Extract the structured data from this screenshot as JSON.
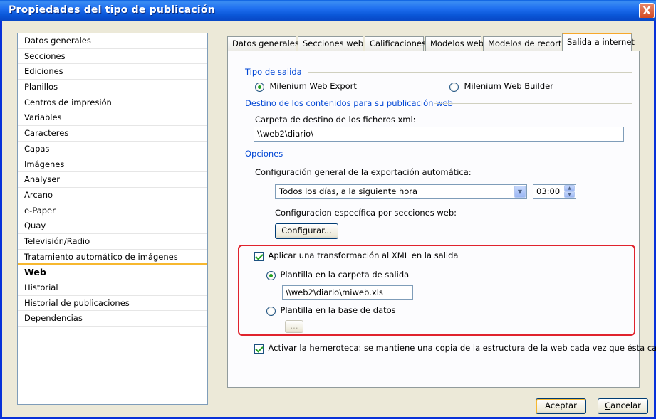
{
  "window": {
    "title": "Propiedades del tipo de publicación",
    "close_label": "X"
  },
  "sidebar": {
    "items": [
      "Datos generales",
      "Secciones",
      "Ediciones",
      "Planillos",
      "Centros de impresión",
      "Variables",
      "Caracteres",
      "Capas",
      "Imágenes",
      "Analyser",
      "Arcano",
      "e-Paper",
      "Quay",
      "Televisión/Radio",
      "Tratamiento automático de imágenes",
      "Web",
      "Historial",
      "Historial de publicaciones",
      "Dependencias"
    ],
    "selected": "Web"
  },
  "tabs": [
    "Datos generales",
    "Secciones web",
    "Calificaciones",
    "Modelos web",
    "Modelos de recorte",
    "Salida a internet"
  ],
  "active_tab": "Salida a internet",
  "output_type": {
    "label": "Tipo de salida",
    "option_export": "Milenium Web Export",
    "option_builder": "Milenium Web Builder",
    "selected": "Milenium Web Export"
  },
  "destination": {
    "label": "Destino de los contenidos para su publicación web",
    "folder_label": "Carpeta de destino de los ficheros xml:",
    "folder_value": "\\\\web2\\diario\\"
  },
  "options": {
    "label": "Opciones",
    "auto_export_label": "Configuración general de la exportación automática:",
    "schedule_value": "Todos los días, a la siguiente hora",
    "time_value": "03:00",
    "per_section_label": "Configuracion específica por secciones web:",
    "configure_button": "Configurar..."
  },
  "transform": {
    "apply_label": "Aplicar una transformación al XML en la salida",
    "apply_checked": true,
    "template_output_label": "Plantilla en la carpeta de salida",
    "template_output_value": "\\\\web2\\diario\\miweb.xls",
    "template_db_label": "Plantilla en la base de datos",
    "browse_button": "...",
    "selected": "output"
  },
  "archive": {
    "label": "Activar la hemeroteca: se mantiene una copia de la estructura de la web cada vez que ésta cambia.",
    "checked": true
  },
  "footer": {
    "accept_button": "Aceptar",
    "cancel_button": "Cancelar"
  },
  "colors": {
    "title_bar": "#0a57d8",
    "group_label": "#0046d5",
    "highlight_box": "#e0232d",
    "tab_active_accent": "#f7a82c"
  }
}
